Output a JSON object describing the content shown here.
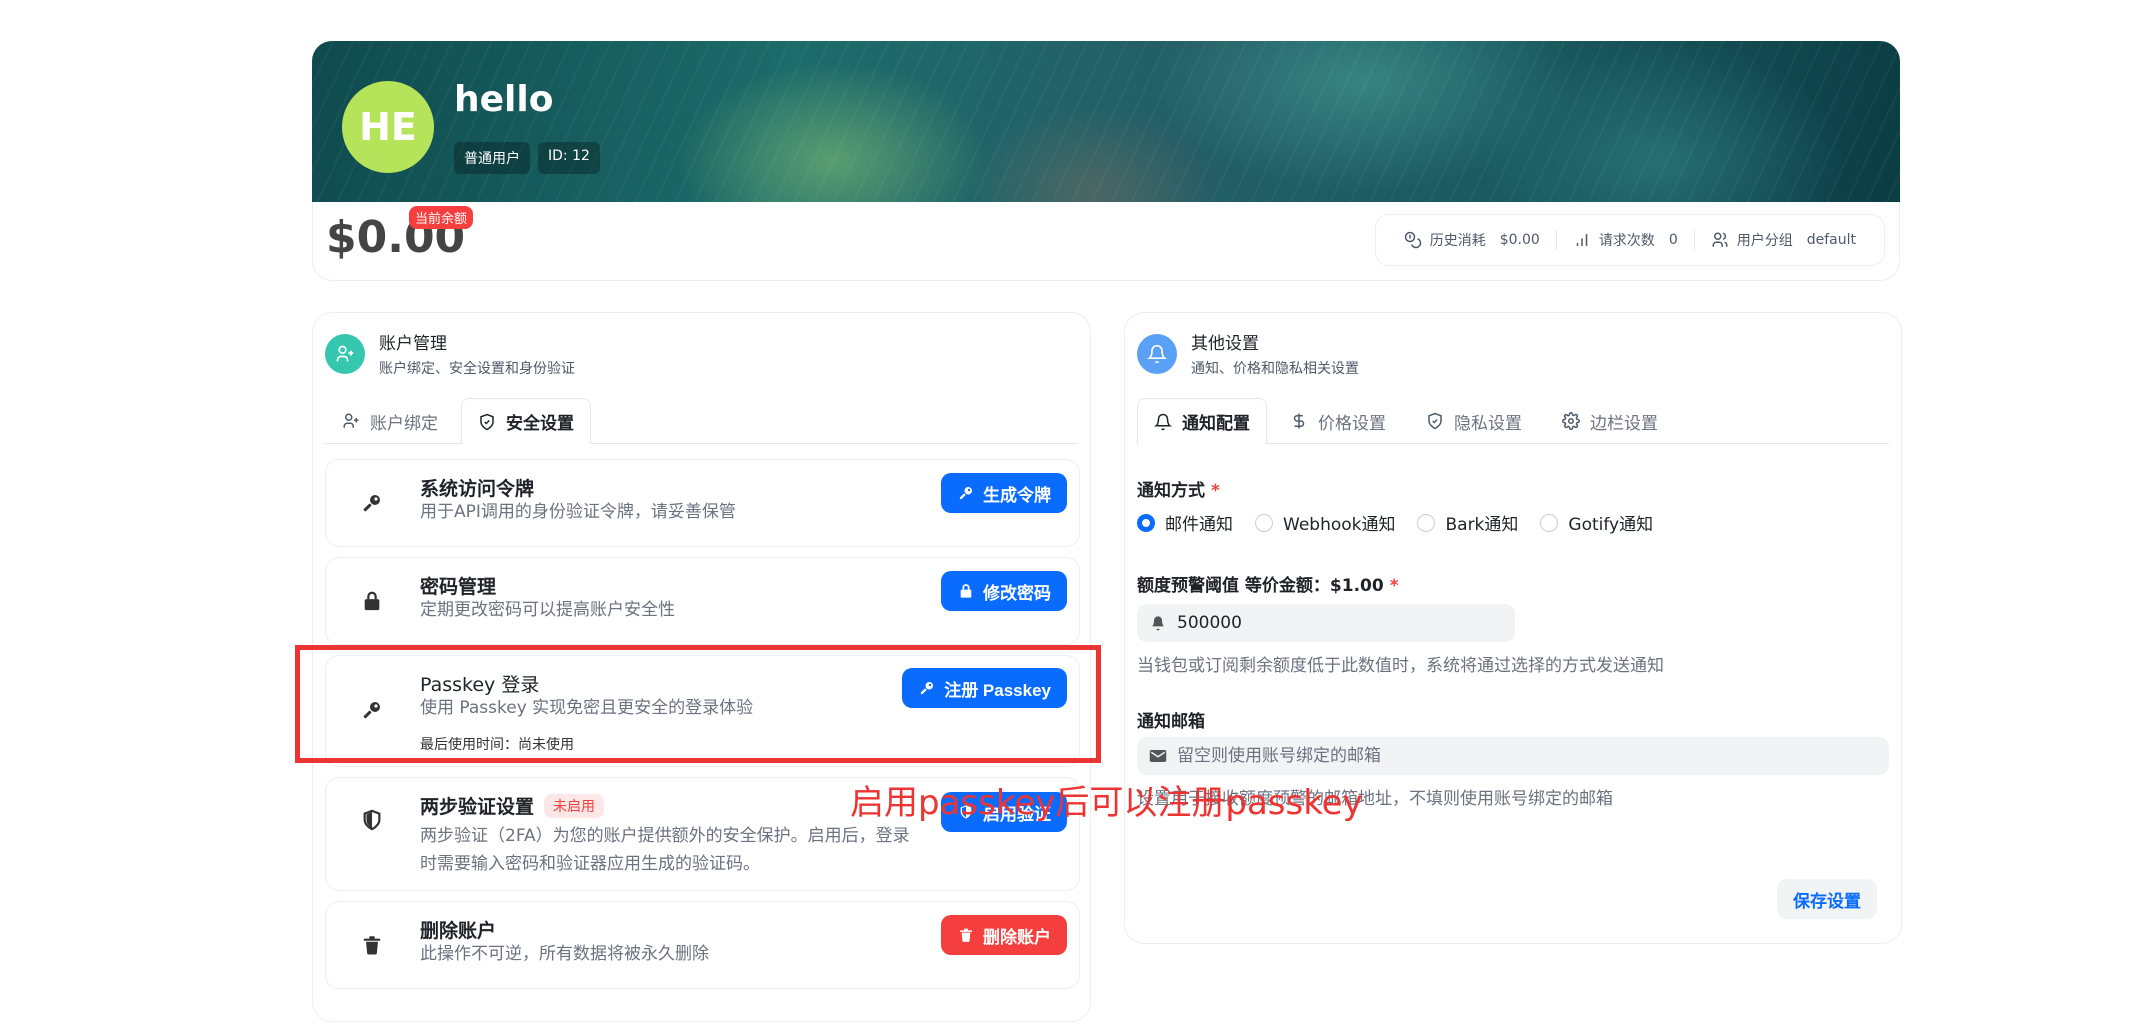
{
  "profile": {
    "avatar_initials": "HE",
    "username": "hello",
    "role": "普通用户",
    "user_id": "ID: 12",
    "balance": "$0.00",
    "balance_tag": "当前余额",
    "stats": [
      {
        "icon": "coins-icon",
        "label": "历史消耗",
        "value": "$0.00"
      },
      {
        "icon": "bar-chart-icon",
        "label": "请求次数",
        "value": "0"
      },
      {
        "icon": "users-icon",
        "label": "用户分组",
        "value": "default"
      }
    ]
  },
  "account": {
    "title": "账户管理",
    "subtitle": "账户绑定、安全设置和身份验证",
    "accent_color": "#36c7b0",
    "tabs": [
      {
        "label": "账户绑定",
        "icon": "user-plus-icon",
        "active": false
      },
      {
        "label": "安全设置",
        "icon": "shield-check-icon",
        "active": true
      }
    ],
    "items": [
      {
        "icon": "key-icon",
        "title": "系统访问令牌",
        "desc": "用于API调用的身份验证令牌，请妥善保管",
        "button": "生成令牌",
        "button_icon": "key-icon"
      },
      {
        "icon": "lock-icon",
        "title": "密码管理",
        "desc": "定期更改密码可以提高账户安全性",
        "button": "修改密码",
        "button_icon": "lock-icon"
      },
      {
        "icon": "key-icon",
        "title": "Passkey 登录",
        "desc": "使用 Passkey 实现免密且更安全的登录体验",
        "meta": "最后使用时间：尚未使用",
        "button": "注册 Passkey",
        "button_icon": "key-icon"
      },
      {
        "icon": "shield-icon",
        "title": "两步验证设置",
        "badge": "未启用",
        "desc": "两步验证（2FA）为您的账户提供额外的安全保护。启用后，登录时需要输入密码和验证器应用生成的验证码。",
        "button": "启用验证",
        "button_icon": "shield-icon"
      },
      {
        "icon": "trash-icon",
        "title": "删除账户",
        "desc": "此操作不可逆，所有数据将被永久删除",
        "button": "删除账户",
        "button_icon": "trash-icon"
      }
    ]
  },
  "other": {
    "title": "其他设置",
    "subtitle": "通知、价格和隐私相关设置",
    "accent_color": "#5aa0f5",
    "tabs": [
      {
        "label": "通知配置",
        "icon": "bell-icon",
        "active": true
      },
      {
        "label": "价格设置",
        "icon": "dollar-icon",
        "active": false
      },
      {
        "label": "隐私设置",
        "icon": "shield-check-icon",
        "active": false
      },
      {
        "label": "边栏设置",
        "icon": "gear-icon",
        "active": false
      }
    ],
    "notify_method_label": "通知方式",
    "notify_methods": [
      {
        "label": "邮件通知",
        "checked": true
      },
      {
        "label": "Webhook通知",
        "checked": false
      },
      {
        "label": "Bark通知",
        "checked": false
      },
      {
        "label": "Gotify通知",
        "checked": false
      }
    ],
    "threshold_label": "额度预警阈值 等价金额：$1.00",
    "threshold_value": "500000",
    "threshold_help": "当钱包或订阅剩余额度低于此数值时，系统将通过选择的方式发送通知",
    "email_label": "通知邮箱",
    "email_placeholder": "留空则使用账号绑定的邮箱",
    "email_help": "设置用于接收额度预警的邮箱地址，不填则使用账号绑定的邮箱",
    "save_button": "保存设置"
  },
  "annotation": {
    "text": "启用passkey后可以注册passkey",
    "color": "#ee3333"
  }
}
